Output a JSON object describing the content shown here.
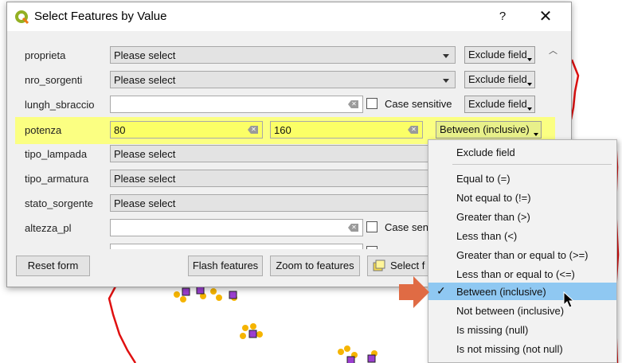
{
  "window": {
    "title": "Select Features by Value",
    "help": "?",
    "close": "✕"
  },
  "fields": [
    {
      "name": "proprieta",
      "type": "combo",
      "value": "Please select",
      "operator": "Exclude field"
    },
    {
      "name": "nro_sorgenti",
      "type": "combo",
      "value": "Please select",
      "operator": "Exclude field"
    },
    {
      "name": "lungh_sbraccio",
      "type": "text",
      "value": "",
      "case_label": "Case sensitive",
      "operator": "Exclude field"
    },
    {
      "name": "potenza",
      "type": "range",
      "value_from": "80",
      "value_to": "160",
      "operator": "Between (inclusive)"
    },
    {
      "name": "tipo_lampada",
      "type": "combo",
      "value": "Please select"
    },
    {
      "name": "tipo_armatura",
      "type": "combo",
      "value": "Please select"
    },
    {
      "name": "stato_sorgente",
      "type": "combo",
      "value": "Please select"
    },
    {
      "name": "altezza_pl",
      "type": "text",
      "value": "",
      "case_label": "Case sensi"
    }
  ],
  "buttons": {
    "reset": "Reset form",
    "flash": "Flash features",
    "zoom": "Zoom to features",
    "select": "Select f"
  },
  "menu": {
    "items": [
      "Exclude field",
      "Equal to (=)",
      "Not equal to (!=)",
      "Greater than (>)",
      "Less than (<)",
      "Greater than or equal to (>=)",
      "Less than or equal to (<=)",
      "Between (inclusive)",
      "Not between (inclusive)",
      "Is missing (null)",
      "Is not missing (not null)"
    ],
    "selected": "Between (inclusive)",
    "check_glyph": "✓"
  },
  "colors": {
    "highlight": "#fbff82",
    "menu_selected": "#8fc8f2",
    "arrow": "#e06b44",
    "map_line": "#e01010",
    "points": "#f5b400",
    "squares": "#9b3fd0"
  }
}
